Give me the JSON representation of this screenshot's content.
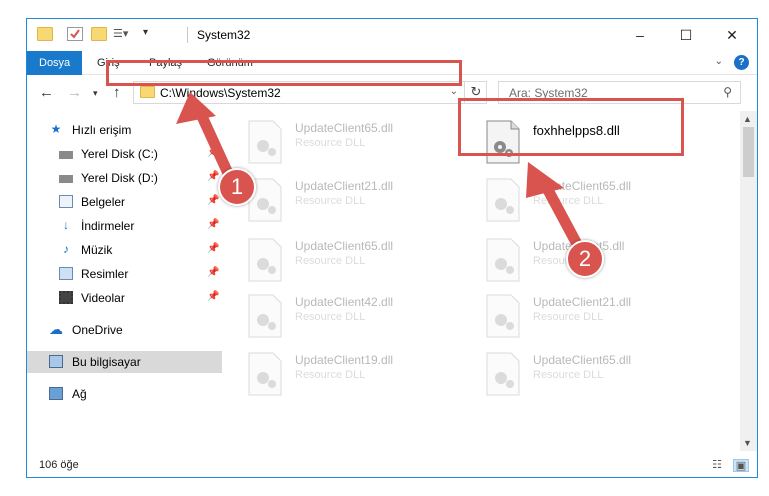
{
  "window": {
    "title": "System32",
    "controls": {
      "minimize": "–",
      "maximize": "☐",
      "close": "✕"
    }
  },
  "ribbon": {
    "tabs": [
      {
        "label": "Dosya",
        "active": true
      },
      {
        "label": "Giriş"
      },
      {
        "label": "Paylaş"
      },
      {
        "label": "Görünüm"
      }
    ],
    "help": "?"
  },
  "nav": {
    "address_path": "C:\\Windows\\System32",
    "search_placeholder": "Ara: System32"
  },
  "sidebar": {
    "items": [
      {
        "label": "Hızlı erişim",
        "icon": "star-icon"
      },
      {
        "label": "Yerel Disk (C:)",
        "icon": "drive-icon",
        "pinned": true
      },
      {
        "label": "Yerel Disk (D:)",
        "icon": "drive-icon",
        "pinned": true
      },
      {
        "label": "Belgeler",
        "icon": "documents-icon",
        "pinned": true
      },
      {
        "label": "İndirmeler",
        "icon": "download-icon",
        "pinned": true
      },
      {
        "label": "Müzik",
        "icon": "music-icon",
        "pinned": true
      },
      {
        "label": "Resimler",
        "icon": "pictures-icon",
        "pinned": true
      },
      {
        "label": "Videolar",
        "icon": "videos-icon",
        "pinned": true
      },
      {
        "label": "OneDrive",
        "icon": "cloud-icon"
      },
      {
        "label": "Bu bilgisayar",
        "icon": "computer-icon",
        "selected": true
      },
      {
        "label": "Ağ",
        "icon": "network-icon"
      }
    ]
  },
  "files": [
    {
      "name": "UpdateClient65.dll",
      "desc": "Resource DLL"
    },
    {
      "name": "foxhhelpps8.dll",
      "desc": "",
      "highlight": true
    },
    {
      "name": "UpdateClient21.dll",
      "desc": "Resource DLL"
    },
    {
      "name": "UpdateClient65.dll",
      "desc": "Resource DLL"
    },
    {
      "name": "UpdateClient65.dll",
      "desc": "Resource DLL"
    },
    {
      "name": "UpdateClient5.dll",
      "desc": "Resource DLL"
    },
    {
      "name": "UpdateClient42.dll",
      "desc": "Resource DLL"
    },
    {
      "name": "UpdateClient21.dll",
      "desc": "Resource DLL"
    },
    {
      "name": "UpdateClient19.dll",
      "desc": "Resource DLL"
    },
    {
      "name": "UpdateClient65.dll",
      "desc": "Resource DLL"
    }
  ],
  "status": {
    "count_text": "106 öğe"
  },
  "callouts": {
    "one": "1",
    "two": "2"
  },
  "colors": {
    "accent": "#1979ca",
    "highlight": "#d9534f",
    "folder": "#f8d775"
  }
}
